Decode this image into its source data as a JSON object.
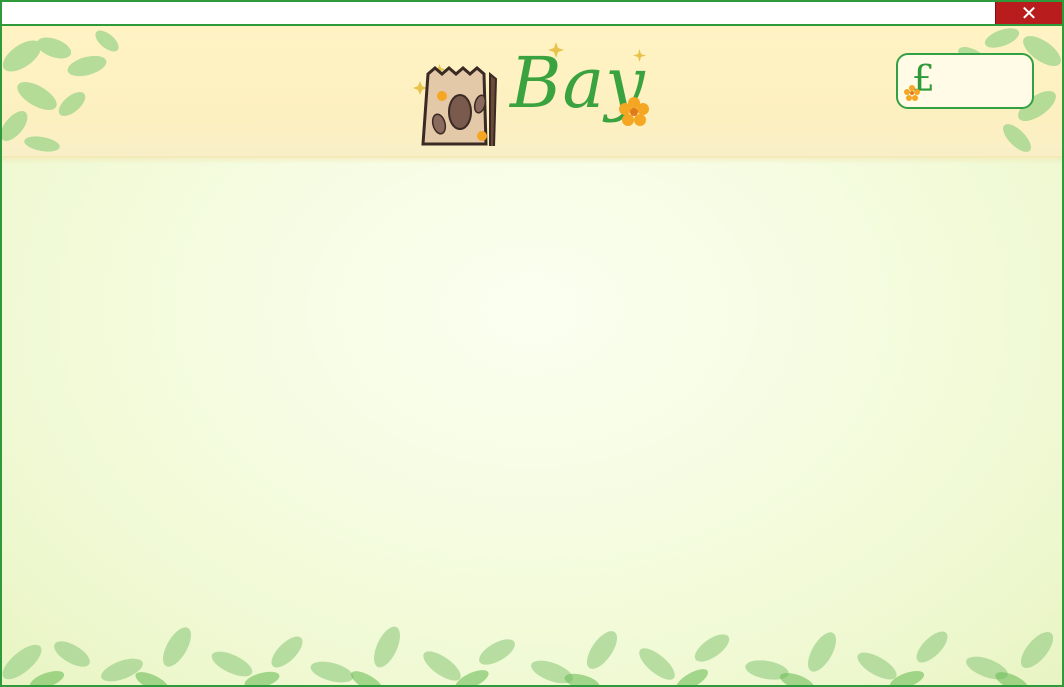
{
  "window": {
    "close_label": "✕"
  },
  "header": {
    "logo_text": "Bay",
    "logo_icon": "seed-bag-icon"
  },
  "balance": {
    "currency_symbol": "£",
    "amount": ""
  },
  "colors": {
    "border": "#2f9a3a",
    "close_button": "#b91c1c",
    "header_bg": "#fff3c4",
    "content_bg": "#f5fce0",
    "leaf": "#7cc46a"
  }
}
